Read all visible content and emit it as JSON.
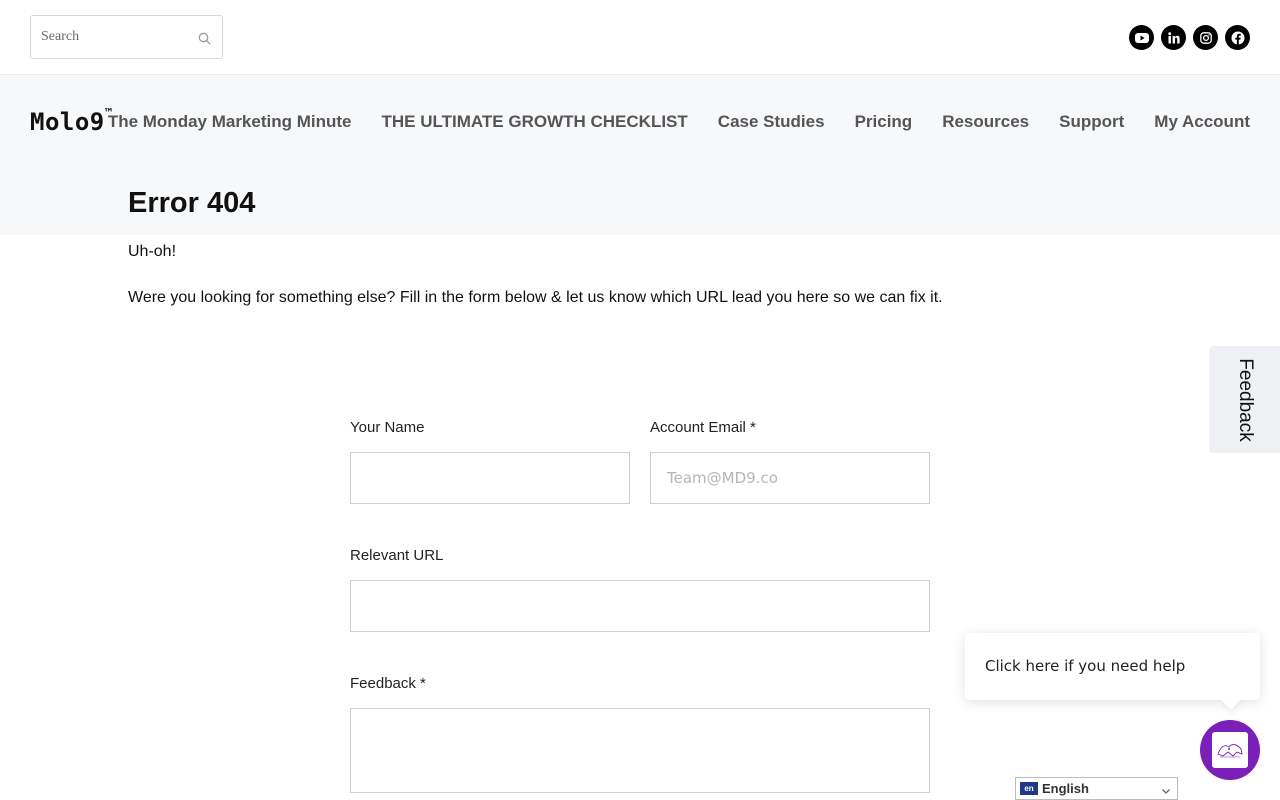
{
  "search": {
    "placeholder": "Search"
  },
  "socials": [
    "youtube-icon",
    "linkedin-icon",
    "instagram-icon",
    "facebook-icon"
  ],
  "brand": {
    "name": "Molo9",
    "mark": "™"
  },
  "nav": {
    "items": [
      {
        "label": "The Monday Marketing Minute"
      },
      {
        "label": "THE ULTIMATE GROWTH CHECKLIST"
      },
      {
        "label": "Case Studies"
      },
      {
        "label": "Pricing"
      },
      {
        "label": "Resources"
      },
      {
        "label": "Support"
      },
      {
        "label": "My Account"
      }
    ]
  },
  "page": {
    "title": "Error 404",
    "intro1": "Uh-oh!",
    "intro2": "Were you looking for something else? Fill in the form below & let us know which URL lead you here so we can fix it."
  },
  "form": {
    "name_label": "Your Name",
    "email_label": "Account Email *",
    "email_placeholder": "Team@MD9.co",
    "url_label": "Relevant URL",
    "feedback_label": "Feedback *"
  },
  "feedback_tab": {
    "label": "Feedback"
  },
  "help": {
    "text": "Click here if you need help"
  },
  "language": {
    "code": "en",
    "label": "English"
  },
  "colors": {
    "chat_accent": "#7a1fb8",
    "header_bg": "#f7f8fa"
  }
}
